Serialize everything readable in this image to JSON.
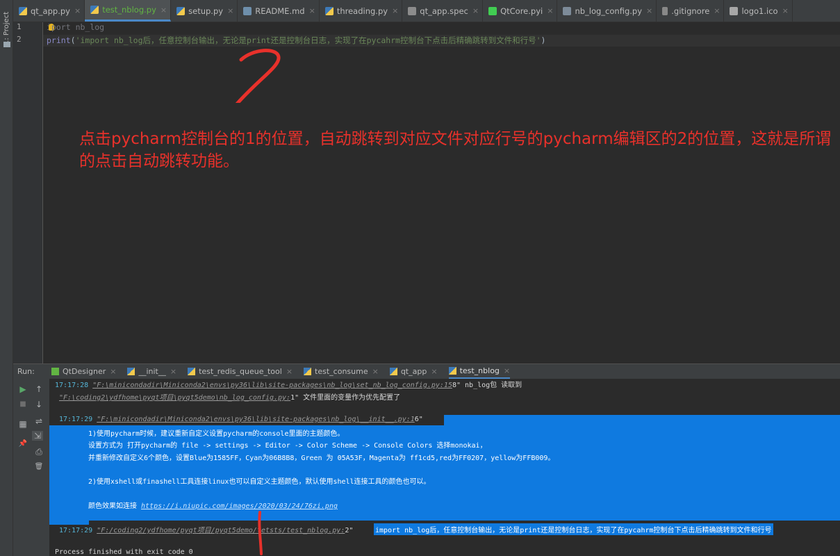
{
  "left_strip": {
    "project_label": "1: Project"
  },
  "tabs": [
    {
      "label": "qt_app.py",
      "icon": "python-file-icon",
      "active": false
    },
    {
      "label": "test_nblog.py",
      "icon": "python-file-icon",
      "active": true
    },
    {
      "label": "setup.py",
      "icon": "python-file-icon",
      "active": false
    },
    {
      "label": "README.md",
      "icon": "markdown-file-icon",
      "active": false
    },
    {
      "label": "threading.py",
      "icon": "python-file-icon",
      "active": false
    },
    {
      "label": "qt_app.spec",
      "icon": "spec-file-icon",
      "active": false
    },
    {
      "label": "QtCore.pyi",
      "icon": "qt-file-icon",
      "active": false
    },
    {
      "label": "nb_log_config.py",
      "icon": "python-file-icon",
      "active": false
    },
    {
      "label": ".gitignore",
      "icon": "gitignore-file-icon",
      "active": false
    },
    {
      "label": "logo1.ico",
      "icon": "image-file-icon",
      "active": false
    }
  ],
  "tab_close_glyph": "×",
  "editor": {
    "line_numbers": [
      "1",
      "2"
    ],
    "line1": {
      "keyword_a": "i",
      "keyword_b": "port",
      "module": " nb_log"
    },
    "line2": {
      "func": "print",
      "open": "(",
      "string": "'import nb_log后，任意控制台输出，无论是print还是控制台日志，实现了在pycahrm控制台下点击后精确跳转到文件和行号'",
      "close": ")"
    },
    "annotation": "点击pycharm控制台的1的位置，自动跳转到对应文件对应行号的pycharm编辑区的2的位置，这就是所谓的点击自动跳转功能。",
    "handwritten_mark": "2"
  },
  "run_panel": {
    "label": "Run:",
    "tabs": [
      {
        "label": "QtDesigner",
        "icon": "run-config-icon"
      },
      {
        "label": "__init__",
        "icon": "python-run-icon"
      },
      {
        "label": "test_redis_queue_tool",
        "icon": "python-run-icon"
      },
      {
        "label": "test_consume",
        "icon": "python-run-icon"
      },
      {
        "label": "qt_app",
        "icon": "python-run-icon"
      },
      {
        "label": "test_nblog",
        "icon": "python-run-icon",
        "active": true
      }
    ],
    "toolbar": {
      "rerun": "▶",
      "stop": "■",
      "up": "↑",
      "down": "↓",
      "wrap": "⇌",
      "scroll_end": "⇲",
      "print": "⎙",
      "delete": "🗑",
      "pin": "📌",
      "layout": "▦"
    },
    "console": {
      "l1_time": "17:17:28",
      "l1_path": "\"F:\\minicondadir\\Miniconda2\\envs\\py36\\lib\\site-packages\\nb_log\\set_nb_log_config.py:15",
      "l1_rest": "8\"   nb_log包 读取到",
      "l2_path": "\"F:\\coding2\\ydfhome\\pyqt项目\\pyqt5demo\\nb_log_config.py:",
      "l2_rest": "1\" 文件里面的变量作为优先配置了",
      "l3_time": "17:17:29",
      "l3_path": "\"F:\\minicondadir\\Miniconda2\\envs\\py36\\lib\\site-packages\\nb_log\\__init__.py:1",
      "l3_rest": "6\"",
      "tip1": "1)使用pycharm时候，建议重新自定义设置pycharm的console里面的主题颜色。",
      "tip2": "设置方式为 打开pycharm的 file -> settings -> Editor -> Color Scheme -> Console Colors 选择monokai，",
      "tip3": "并重新修改自定义6个颜色，设置Blue为1585FF，Cyan为06B8B8，Green 为 05A53F，Magenta为 ff1cd5,red为FF0207，yellow为FFB009。",
      "tip4": "2)使用xshell或finashell工具连接linux也可以自定义主题颜色，默认使用shell连接工具的颜色也可以。",
      "tip5_label": "颜色效果如连接 ",
      "tip5_link": "https://i.niupic.com/images/2020/03/24/76zi.png",
      "l4_time": "17:17:29",
      "l4_path": "\"F:/coding2/ydfhome/pyqt项目/pyqt5demo/tetsts/test_nblog.py:",
      "l4_lineno": "2\"",
      "l4_msg": "import nb_log后，任意控制台输出，无论是print还是控制台日志，实现了在pycahrm控制台下点击后精确跳转到文件和行号",
      "handwritten_mark": "1",
      "finish": "Process finished with exit code 0"
    }
  },
  "colors": {
    "annotation": "#e8312b",
    "selection": "#0f7ae0",
    "time": "#55b6d8",
    "active_tab_text": "#62b543"
  }
}
